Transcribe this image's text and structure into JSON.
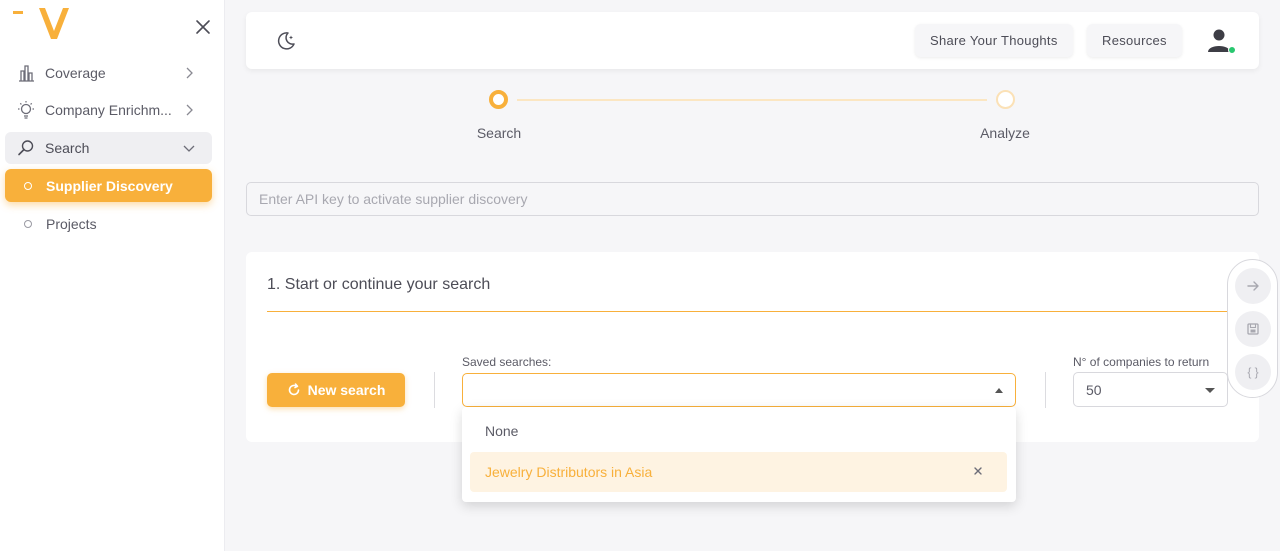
{
  "brand": {
    "logo": "V",
    "accent": "#f8b03b"
  },
  "sidebar": {
    "items": [
      {
        "label": "Coverage",
        "icon": "bar-chart-icon"
      },
      {
        "label": "Company Enrichm...",
        "icon": "lightbulb-icon"
      },
      {
        "label": "Search",
        "icon": "search-icon"
      }
    ],
    "subitems": [
      {
        "label": "Supplier Discovery",
        "selected": true
      },
      {
        "label": "Projects",
        "selected": false
      }
    ]
  },
  "topbar": {
    "share_label": "Share Your Thoughts",
    "resources_label": "Resources"
  },
  "stepper": {
    "steps": [
      {
        "label": "Search",
        "active": true
      },
      {
        "label": "Analyze",
        "active": false
      }
    ]
  },
  "api_key": {
    "placeholder": "Enter API key to activate supplier discovery",
    "value": ""
  },
  "search_card": {
    "title": "1. Start or continue your search",
    "new_search_label": "New search",
    "saved_label": "Saved searches:",
    "saved_value": "",
    "count_label": "N° of companies to return",
    "count_value": "50"
  },
  "dropdown": {
    "options": [
      "None",
      "Jewelry Distributors in Asia"
    ],
    "highlighted": "Jewelry Distributors in Asia"
  },
  "fab": {
    "icons": [
      "arrow-right-icon",
      "save-icon",
      "braces-icon"
    ],
    "braces_text": "{ }"
  }
}
